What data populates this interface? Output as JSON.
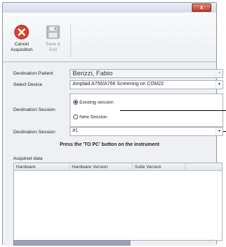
{
  "window": {
    "close_label": "x"
  },
  "toolbar": {
    "cancel_label_1": "Cancel",
    "cancel_label_2": "Acquisition",
    "save_label_1": "Save &",
    "save_label_2": "Exit"
  },
  "form": {
    "patient_label": "Destination Patient",
    "patient_value": "Berizzi, Fabio",
    "device_label": "Select Device",
    "device_value": "Amplaid A756/A766 Screening on COM22",
    "session_type_label": "Destination Session",
    "session_options": [
      {
        "label": "Existing session",
        "selected": true
      },
      {
        "label": "New Session",
        "selected": false
      }
    ],
    "session_label": "Destination Session",
    "session_value": "#1",
    "instruction": "Press the 'TO PC' button on the instrument",
    "acquired_label": "Acquired data"
  },
  "grid": {
    "columns": [
      "Hardware",
      "Hardware Version",
      "Suite Version"
    ]
  },
  "colors": {
    "cancel_red": "#d9412f",
    "progress": "#9aa4b1"
  },
  "icons": {
    "cancel": "cancel-x-icon",
    "save": "floppy-disk-icon",
    "dropdown": "chevron-down-icon"
  }
}
